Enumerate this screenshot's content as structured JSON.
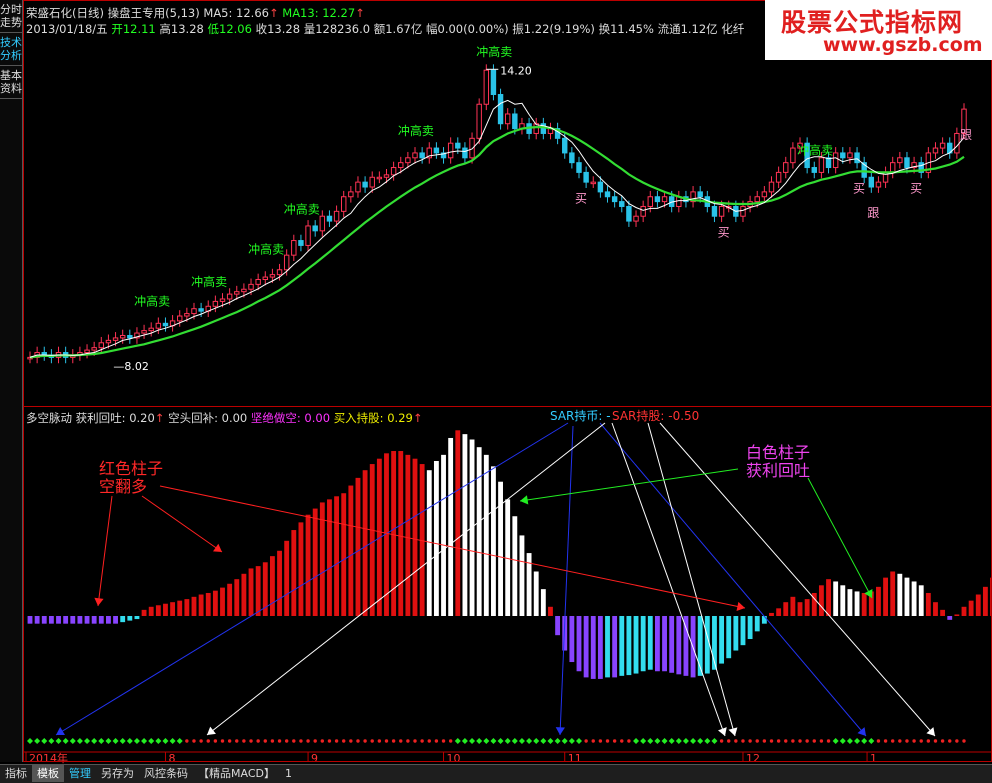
{
  "side_tabs": [
    "分时走势",
    "技术分析",
    "基本资料"
  ],
  "header": {
    "title": "荣盛石化(日线)",
    "formula": "操盘王专用",
    "params": "(5,13)",
    "ma5_label": "MA5:",
    "ma5_value": "12.66",
    "ma13_label": "MA13:",
    "ma13_value": "12.27",
    "up_arrow": "↑",
    "date": "2013/01/18/五",
    "open_label": "开",
    "open": "12.11",
    "high_label": "高",
    "high": "13.28",
    "low_label": "低",
    "low": "12.06",
    "close_label": "收",
    "close": "13.28",
    "vol_label": "量",
    "vol": "128236.0",
    "amount_label": "额",
    "amount": "1.67亿",
    "range_label": "幅",
    "range": "0.00(0.00%)",
    "swing_label": "振",
    "swing": "1.22(9.19%)",
    "turn_label": "换",
    "turn": "11.45%",
    "float_label": "流通",
    "float": "1.12亿",
    "sector": "化纤"
  },
  "logo": {
    "cn": "股票公式指标网",
    "url": "www.gszb.com"
  },
  "price_labels": {
    "high": "14.20",
    "low": "8.02"
  },
  "signals": {
    "sell": "冲高卖",
    "buy": "买",
    "follow": "跟"
  },
  "indicator": {
    "name": "多空脉动",
    "profit_label": "获利回吐:",
    "profit": "0.20",
    "short_label": "空头回补:",
    "short": "0.00",
    "firm_short_label": "坚绝做空:",
    "firm_short": "0.00",
    "hold_label": "买入持股:",
    "hold": "0.29",
    "sar_currency": "SAR持币: -",
    "sar_hold": "SAR持股: -0.50",
    "arrow": "↑"
  },
  "annotations": {
    "red_bar_1": "红色柱子",
    "red_bar_2": "空翻多",
    "white_bar_1": "白色柱子",
    "white_bar_2": "获利回吐"
  },
  "x_axis": {
    "labels": [
      "2014年",
      "8",
      "9",
      "10",
      "11",
      "12",
      "1"
    ]
  },
  "bottom_tabs": [
    "指标",
    "模板",
    "管理",
    "另存为",
    "风控条码",
    "【精品MACD】",
    "1"
  ],
  "colors": {
    "up": "#ff3355",
    "down": "#2ac3e8",
    "ma5": "#ffffff",
    "ma13": "#33dd33",
    "hist_pos": "#e01010",
    "hist_neg": "#8844ff",
    "hist_white": "#ffffff",
    "hist_cyan": "#33ddee",
    "sar_green": "#22ee22",
    "sar_red": "#ee2222"
  },
  "chart_data": {
    "type": "candlestick",
    "price_range": [
      8.02,
      14.2
    ],
    "closes": [
      8.2,
      8.3,
      8.25,
      8.2,
      8.3,
      8.2,
      8.25,
      8.3,
      8.35,
      8.4,
      8.5,
      8.55,
      8.6,
      8.65,
      8.6,
      8.7,
      8.75,
      8.8,
      8.9,
      8.85,
      8.95,
      9.05,
      9.1,
      9.2,
      9.15,
      9.25,
      9.35,
      9.4,
      9.5,
      9.55,
      9.6,
      9.7,
      9.8,
      9.85,
      9.9,
      10.0,
      10.3,
      10.6,
      10.5,
      10.9,
      10.8,
      11.1,
      11.0,
      11.2,
      11.5,
      11.6,
      11.8,
      11.7,
      11.9,
      11.9,
      11.95,
      12.1,
      12.2,
      12.3,
      12.4,
      12.3,
      12.5,
      12.4,
      12.3,
      12.6,
      12.5,
      12.3,
      12.7,
      13.4,
      14.1,
      13.6,
      13.0,
      13.2,
      12.9,
      13.0,
      12.8,
      13.0,
      12.8,
      12.9,
      12.7,
      12.4,
      12.2,
      12.0,
      11.8,
      11.8,
      11.6,
      11.5,
      11.4,
      11.3,
      11.0,
      11.1,
      11.3,
      11.5,
      11.4,
      11.5,
      11.3,
      11.5,
      11.4,
      11.6,
      11.5,
      11.3,
      11.1,
      11.3,
      11.3,
      11.1,
      11.3,
      11.4,
      11.5,
      11.6,
      11.8,
      12.0,
      12.2,
      12.5,
      12.6,
      12.1,
      12.0,
      12.3,
      12.1,
      12.4,
      12.3,
      12.4,
      12.2,
      11.9,
      11.7,
      11.8,
      12.0,
      12.2,
      12.3,
      12.1,
      12.2,
      12.0,
      12.4,
      12.5,
      12.6,
      12.4,
      12.8,
      13.3
    ],
    "ma5": [
      8.2,
      8.25,
      8.25,
      8.24,
      8.25,
      8.25,
      8.24,
      8.25,
      8.28,
      8.3,
      8.36,
      8.42,
      8.48,
      8.55,
      8.58,
      8.62,
      8.66,
      8.7,
      8.76,
      8.8,
      8.85,
      8.91,
      8.97,
      9.04,
      9.09,
      9.15,
      9.21,
      9.27,
      9.33,
      9.41,
      9.47,
      9.54,
      9.61,
      9.7,
      9.77,
      9.85,
      9.97,
      10.11,
      10.23,
      10.38,
      10.52,
      10.66,
      10.79,
      10.92,
      11.06,
      11.16,
      11.35,
      11.5,
      11.63,
      11.7,
      11.81,
      11.93,
      12.01,
      12.11,
      12.2,
      12.26,
      12.34,
      12.36,
      12.38,
      12.42,
      12.44,
      12.43,
      12.48,
      12.64,
      12.97,
      13.3,
      13.42,
      13.48,
      13.4,
      13.42,
      13.19,
      12.98,
      12.96,
      12.92,
      12.84,
      12.74,
      12.62,
      12.44,
      12.22,
      12.02,
      11.88,
      11.74,
      11.62,
      11.52,
      11.36,
      11.28,
      11.22,
      11.26,
      11.26,
      11.32,
      11.39,
      11.42,
      11.42,
      11.46,
      11.48,
      11.42,
      11.36,
      11.34,
      11.28,
      11.2,
      11.22,
      11.28,
      11.32,
      11.38,
      11.5,
      11.62,
      11.78,
      11.98,
      12.16,
      12.28,
      12.32,
      12.32,
      12.28,
      12.3,
      12.22,
      12.26,
      12.28,
      12.16,
      12.06,
      11.98,
      11.96,
      11.98,
      12.04,
      12.08,
      12.12,
      12.14,
      12.2,
      12.24,
      12.34,
      12.4,
      12.54,
      12.72
    ],
    "ma13": [
      8.2,
      8.22,
      8.23,
      8.23,
      8.24,
      8.24,
      8.24,
      8.25,
      8.26,
      8.27,
      8.29,
      8.32,
      8.35,
      8.38,
      8.41,
      8.44,
      8.47,
      8.51,
      8.55,
      8.59,
      8.63,
      8.68,
      8.73,
      8.78,
      8.83,
      8.89,
      8.95,
      9.01,
      9.07,
      9.13,
      9.2,
      9.27,
      9.35,
      9.42,
      9.5,
      9.58,
      9.68,
      9.79,
      9.9,
      10.02,
      10.13,
      10.25,
      10.37,
      10.49,
      10.61,
      10.73,
      10.85,
      10.97,
      11.08,
      11.19,
      11.3,
      11.4,
      11.5,
      11.6,
      11.69,
      11.77,
      11.86,
      11.94,
      12.01,
      12.08,
      12.14,
      12.18,
      12.24,
      12.36,
      12.52,
      12.64,
      12.72,
      12.8,
      12.85,
      12.9,
      12.92,
      12.93,
      12.93,
      12.91,
      12.87,
      12.82,
      12.75,
      12.67,
      12.58,
      12.48,
      12.38,
      12.28,
      12.17,
      12.07,
      11.96,
      11.87,
      11.79,
      11.72,
      11.66,
      11.6,
      11.55,
      11.5,
      11.46,
      11.43,
      11.42,
      11.4,
      11.38,
      11.37,
      11.36,
      11.35,
      11.35,
      11.35,
      11.37,
      11.39,
      11.42,
      11.47,
      11.54,
      11.62,
      11.7,
      11.76,
      11.8,
      11.85,
      11.88,
      11.92,
      11.96,
      12.0,
      12.02,
      12.02,
      12.01,
      12.0,
      12.0,
      12.0,
      12.01,
      12.02,
      12.03,
      12.04,
      12.06,
      12.08,
      12.12,
      12.16,
      12.22,
      12.32
    ],
    "histogram": [
      -0.1,
      -0.1,
      -0.1,
      -0.1,
      -0.1,
      -0.1,
      -0.1,
      -0.1,
      -0.1,
      -0.1,
      -0.1,
      -0.1,
      -0.1,
      -0.08,
      -0.06,
      -0.04,
      0.08,
      0.12,
      0.14,
      0.16,
      0.18,
      0.2,
      0.22,
      0.25,
      0.28,
      0.3,
      0.33,
      0.37,
      0.42,
      0.48,
      0.55,
      0.62,
      0.65,
      0.7,
      0.78,
      0.85,
      0.98,
      1.12,
      1.22,
      1.32,
      1.4,
      1.48,
      1.52,
      1.56,
      1.6,
      1.7,
      1.8,
      1.9,
      1.98,
      2.05,
      2.12,
      2.15,
      2.15,
      2.1,
      2.05,
      1.98,
      1.9,
      2.02,
      2.1,
      2.32,
      2.42,
      2.37,
      2.3,
      2.2,
      2.1,
      1.95,
      1.75,
      1.52,
      1.3,
      1.05,
      0.82,
      0.58,
      0.35,
      0.12,
      -0.25,
      -0.45,
      -0.6,
      -0.72,
      -0.8,
      -0.82,
      -0.82,
      -0.8,
      -0.8,
      -0.78,
      -0.77,
      -0.75,
      -0.72,
      -0.7,
      -0.72,
      -0.72,
      -0.74,
      -0.76,
      -0.78,
      -0.8,
      -0.78,
      -0.75,
      -0.7,
      -0.62,
      -0.55,
      -0.45,
      -0.38,
      -0.3,
      -0.2,
      -0.1,
      0.04,
      0.1,
      0.18,
      0.25,
      0.18,
      0.22,
      0.3,
      0.4,
      0.48,
      0.45,
      0.4,
      0.35,
      0.32,
      0.3,
      0.32,
      0.38,
      0.5,
      0.58,
      0.55,
      0.5,
      0.45,
      0.4,
      0.3,
      0.18,
      0.08,
      -0.05,
      0.02,
      0.12,
      0.2,
      0.28,
      0.38,
      0.5,
      0.55,
      0.55,
      0.5,
      0.65,
      0.85
    ],
    "annotated_high": 14.2,
    "annotated_low": 8.02
  }
}
